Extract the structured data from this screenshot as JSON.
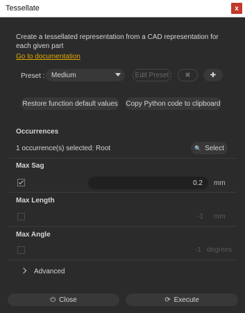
{
  "window": {
    "title": "Tessellate",
    "close_glyph": "x"
  },
  "description": "Create a tessellated representation from a CAD representation for each given part",
  "doc_link": "Go to documentation",
  "preset": {
    "label": "Preset :",
    "value": "Medium",
    "edit_label": "Edit Preset",
    "delete_glyph": "✖",
    "add_glyph": "✚"
  },
  "actions": {
    "restore_label": "Restore function default values",
    "copy_label": "Copy Python code to clipboard"
  },
  "occurrences": {
    "heading": "Occurrences",
    "selection_text": "1 occurrence(s) selected: Root",
    "select_label": "Select",
    "select_icon": "🔍"
  },
  "max_sag": {
    "heading": "Max Sag",
    "checked": true,
    "value": "0.2",
    "unit": "mm"
  },
  "max_length": {
    "heading": "Max Length",
    "checked": false,
    "value": "-1",
    "unit": "mm"
  },
  "max_angle": {
    "heading": "Max Angle",
    "checked": false,
    "value": "-1",
    "unit": "degrees"
  },
  "advanced": {
    "label": "Advanced"
  },
  "footer": {
    "close_label": "Close",
    "close_icon": "⏻",
    "execute_label": "Execute",
    "execute_icon": "⟳"
  },
  "colors": {
    "accent_link": "#e2a800",
    "close_red": "#c0392b",
    "background": "#2b2b2b"
  }
}
